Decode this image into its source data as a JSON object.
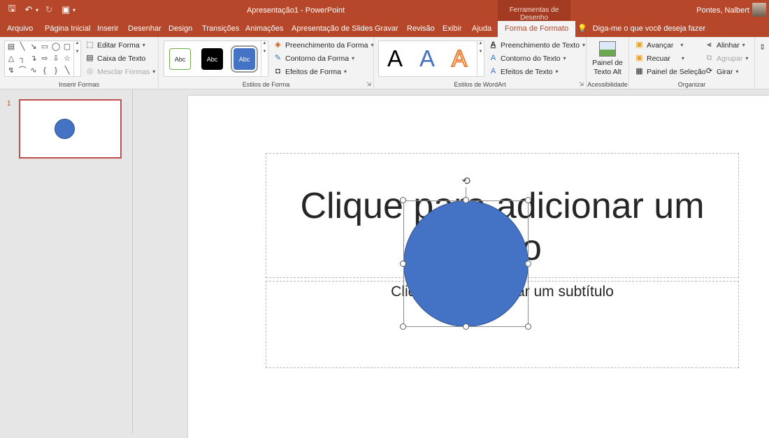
{
  "titlebar": {
    "document": "Apresentação1",
    "separator": " - ",
    "app": "PowerPoint",
    "contextual_group": "Ferramentas de Desenho",
    "user": "Pontes, Nalbert"
  },
  "tabs": [
    {
      "label": "Arquivo"
    },
    {
      "label": "Página Inicial"
    },
    {
      "label": "Inserir"
    },
    {
      "label": "Desenhar"
    },
    {
      "label": "Design"
    },
    {
      "label": "Transições"
    },
    {
      "label": "Animações"
    },
    {
      "label": "Apresentação de Slides"
    },
    {
      "label": "Gravar"
    },
    {
      "label": "Revisão"
    },
    {
      "label": "Exibir"
    },
    {
      "label": "Ajuda"
    },
    {
      "label": "Forma de Formato",
      "active": true
    }
  ],
  "tell_me": "Diga-me o que você deseja fazer",
  "ribbon": {
    "insert_shapes": {
      "label": "Inserir Formas",
      "edit_shape": "Editar Forma",
      "text_box": "Caixa de Texto",
      "merge_shapes": "Mesclar Formas"
    },
    "shape_styles": {
      "label": "Estilos de Forma",
      "presets": [
        "Abc",
        "Abc",
        "Abc"
      ],
      "fill": "Preenchimento da Forma",
      "outline": "Contorno da Forma",
      "effects": "Efeitos de Forma"
    },
    "wordart_styles": {
      "label": "Estilos de WordArt",
      "presets": [
        "A",
        "A",
        "A"
      ],
      "text_fill": "Preenchimento de Texto",
      "text_outline": "Contorno do Texto",
      "text_effects": "Efeitos de Texto"
    },
    "accessibility": {
      "label": "Acessibilidade",
      "alt_text_line1": "Painel de",
      "alt_text_line2": "Texto Alt"
    },
    "arrange": {
      "label": "Organizar",
      "bring_forward": "Avançar",
      "send_backward": "Recuar",
      "selection_pane": "Painel de Seleção",
      "align": "Alinhar",
      "group": "Agrupar",
      "rotate": "Girar"
    }
  },
  "thumbnails": [
    {
      "number": "1"
    }
  ],
  "slide": {
    "title_placeholder": "Clique para adicionar um título",
    "subtitle_placeholder": "Clique para adicionar um subtítulo"
  },
  "colors": {
    "accent": "#b7472a",
    "shape_fill": "#4472c4",
    "shape_outline": "#2f528f"
  }
}
